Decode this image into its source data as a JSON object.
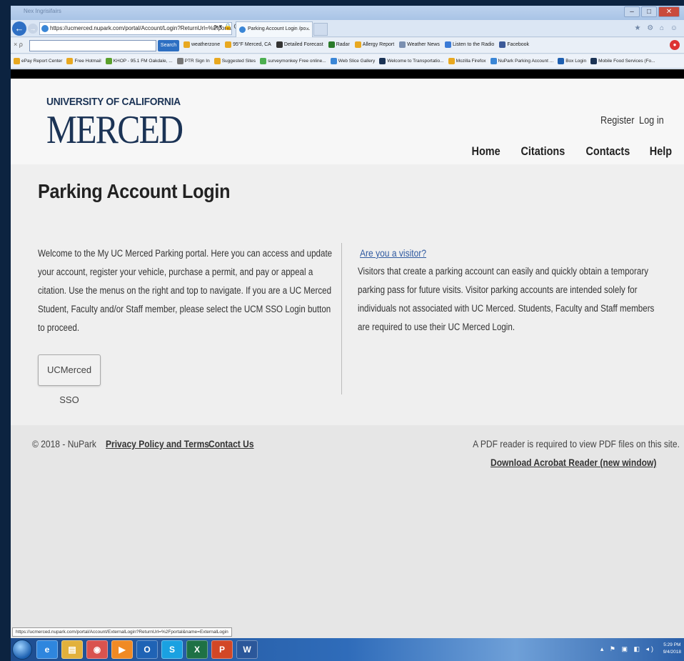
{
  "browser": {
    "title_text": "Nex  Ingrisifairs",
    "back_glyph": "←",
    "forward_glyph": "→",
    "address": "https://ucmerced.nupark.com/portal/Account/Login?ReturnUrl=%2fportal",
    "address_tools": "ρ ▾ 🔒 C",
    "tab_title": "Parking Account Login /po...",
    "tab_close": "×",
    "right_icons": "★ ⚙ ⌂ ☺",
    "window_buttons": [
      "–",
      "□",
      "✕"
    ]
  },
  "toolbar": {
    "close_glyph": "× ρ",
    "search_button": "Search",
    "items": [
      {
        "label": "weatherzone",
        "color": "#e8a820"
      },
      {
        "label": "95°F Merced, CA",
        "color": "#e8a820"
      },
      {
        "label": "Detailed Forecast",
        "color": "#333333"
      },
      {
        "label": "Radar",
        "color": "#2a7a2a"
      },
      {
        "label": "Allergy Report",
        "color": "#e8a820"
      },
      {
        "label": "Weather News",
        "color": "#7a8fb0"
      },
      {
        "label": "Listen to the Radio",
        "color": "#3a7ad6"
      },
      {
        "label": "Facebook",
        "color": "#3b5998"
      }
    ]
  },
  "favorites": [
    {
      "label": "ePay Report Center",
      "color": "#e8a820"
    },
    {
      "label": "Free Hotmail",
      "color": "#e8a820"
    },
    {
      "label": "KHOP - 95.1 FM Oakdale, ...",
      "color": "#5aa02c"
    },
    {
      "label": "PTR Sign In",
      "color": "#777777"
    },
    {
      "label": "Suggested Sites",
      "color": "#e8a820"
    },
    {
      "label": "surveymonkey Free online...",
      "color": "#4caf50"
    },
    {
      "label": "Web Slice Gallery",
      "color": "#3a86d6"
    },
    {
      "label": "Welcome to Transportatio...",
      "color": "#1b3355"
    },
    {
      "label": "Mozilla Firefox",
      "color": "#e8a820"
    },
    {
      "label": "NuPark Parking Account ...",
      "color": "#3a86d6"
    },
    {
      "label": "Box Login",
      "color": "#1e5fb0"
    },
    {
      "label": "Mobile Food Services (Fo...",
      "color": "#1b3355"
    }
  ],
  "header": {
    "logo_line1": "UNIVERSITY OF CALIFORNIA",
    "logo_line2": "MERCED",
    "register": "Register",
    "login": "Log in",
    "nav": [
      "Home",
      "Citations",
      "Contacts",
      "Help"
    ]
  },
  "main": {
    "title": "Parking Account Login",
    "welcome_text": "Welcome to the My UC Merced Parking portal. Here you can access and update your account, register your vehicle, purchase a permit, and pay or appeal a citation. Use the menus on the right and top to navigate. If you are a UC Merced Student, Faculty and/or Staff member, please select the UCM SSO Login button to proceed.",
    "sso_button": "UCMerced SSO",
    "visitor_link": "Are you a visitor?",
    "visitor_text": "Visitors that create a parking account can easily and quickly obtain a temporary parking pass for future visits. Visitor parking accounts are intended solely for individuals not associated with UC Merced. Students, Faculty and Staff members are required to use their UC Merced Login."
  },
  "footer": {
    "copyright": "© 2018 - NuPark",
    "privacy": "Privacy Policy and Terms",
    "contact": "Contact Us",
    "pdf_note": "A PDF reader is required to view PDF files on this site.",
    "acrobat": "Download Acrobat Reader (new window)"
  },
  "status": {
    "url": "https://ucmerced.nupark.com/portal/Account/ExternalLogin?ReturnUrl=%2Fportal&name=ExternalLogin"
  },
  "taskbar": {
    "apps": [
      {
        "name": "ie",
        "glyph": "e"
      },
      {
        "name": "explorer",
        "glyph": "▤"
      },
      {
        "name": "chrome",
        "glyph": "◉"
      },
      {
        "name": "media",
        "glyph": "▶"
      },
      {
        "name": "outlook",
        "glyph": "O"
      },
      {
        "name": "skype",
        "glyph": "S"
      },
      {
        "name": "excel",
        "glyph": "X"
      },
      {
        "name": "powerpoint",
        "glyph": "P"
      },
      {
        "name": "word",
        "glyph": "W"
      }
    ],
    "tray_icons": "▴ ⚑ ▣ ◧ ◂)",
    "time": "5:29 PM",
    "date": "9/4/2018"
  }
}
